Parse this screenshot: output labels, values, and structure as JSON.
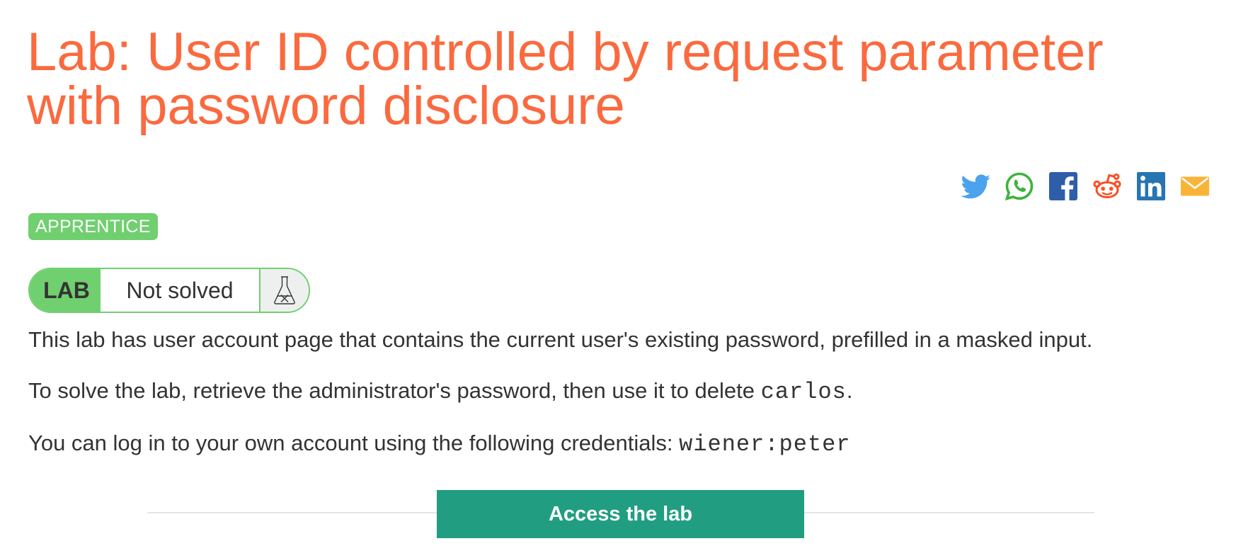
{
  "page": {
    "title": "Lab: User ID controlled by request parameter with password disclosure"
  },
  "share": {
    "icons": [
      "twitter-icon",
      "whatsapp-icon",
      "facebook-icon",
      "reddit-icon",
      "linkedin-icon",
      "email-icon"
    ],
    "colors": {
      "twitter": "#4ba2ef",
      "whatsapp": "#3db33c",
      "facebook": "#2f5ea8",
      "reddit": "#fa4f24",
      "linkedin": "#2775b2",
      "email": "#f9b438"
    }
  },
  "level_badge": "APPRENTICE",
  "status": {
    "tag": "LAB",
    "text": "Not solved",
    "icon": "flask-x-icon"
  },
  "description": {
    "p1": "This lab has user account page that contains the current user's existing password, prefilled in a masked input.",
    "p2_before": "To solve the lab, retrieve the administrator's password, then use it to delete ",
    "p2_code": "carlos",
    "p2_after": ".",
    "p3_before": "You can log in to your own account using the following credentials: ",
    "p3_code": "wiener:peter"
  },
  "access_button": "Access the lab",
  "colors": {
    "title": "#fa6a3f",
    "badge": "#70cf6f",
    "button": "#219e81",
    "text": "#333332"
  }
}
